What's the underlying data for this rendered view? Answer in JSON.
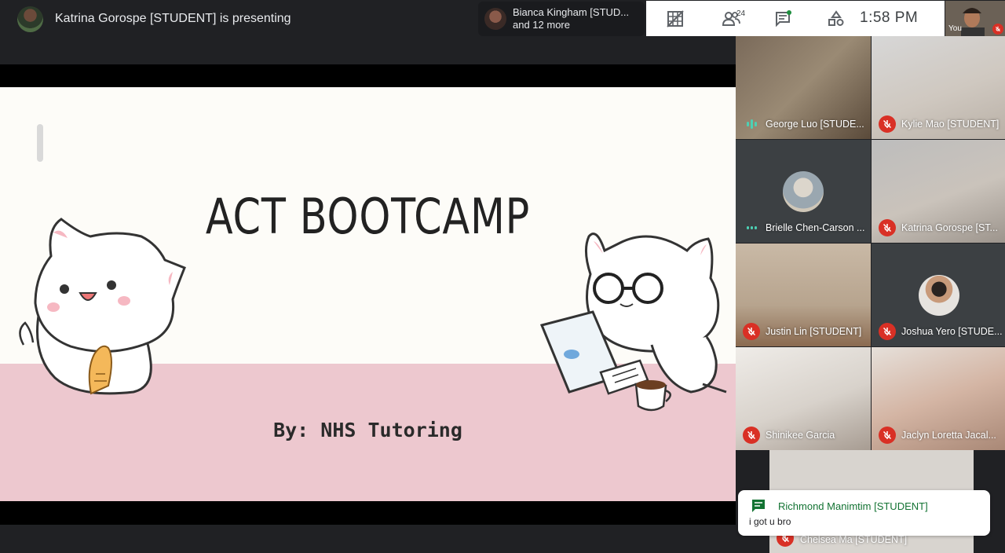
{
  "presenter": {
    "text": "Katrina Gorospe [STUDENT] is presenting"
  },
  "slide": {
    "title": "ACT BOOTCAMP",
    "subtitle": "By: NHS Tutoring"
  },
  "viewers": {
    "line1": "Bianca Kingham [STUD...",
    "line2": "and 12 more"
  },
  "toolbar": {
    "participants_count": "24",
    "time": "1:58  PM",
    "icons": [
      "layout-icon",
      "people-icon",
      "chat-icon",
      "activities-icon"
    ]
  },
  "self_view": {
    "label": "You"
  },
  "participants": [
    {
      "name": "George Luo [STUDE...",
      "mic": "speaking"
    },
    {
      "name": "Kylie Mao [STUDENT]",
      "mic": "off"
    },
    {
      "name": "Brielle Chen-Carson ...",
      "mic": "speaking"
    },
    {
      "name": "Katrina Gorospe [ST...",
      "mic": "off"
    },
    {
      "name": "Justin Lin [STUDENT]",
      "mic": "off"
    },
    {
      "name": "Joshua Yero [STUDE...",
      "mic": "off"
    },
    {
      "name": "Shinikee Garcia",
      "mic": "off"
    },
    {
      "name": "Jaclyn Loretta Jacal...",
      "mic": "off"
    },
    {
      "name": "Chelsea Ma [STUDENT]",
      "mic": "off"
    }
  ],
  "chat_toast": {
    "sender": "Richmond Manimtim [STUDENT]",
    "message": "i got u bro"
  },
  "colors": {
    "accent_green": "#137333",
    "mic_off_red": "#d93025",
    "speaking": "#4dd0b4",
    "slide_pink": "#edc8cf"
  }
}
